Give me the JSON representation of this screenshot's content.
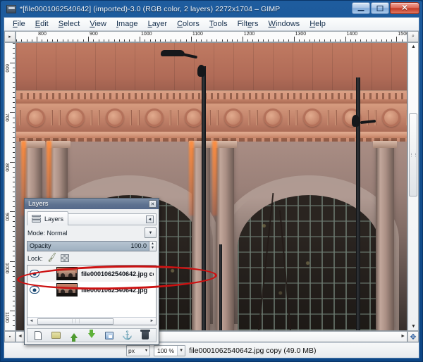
{
  "window": {
    "title": "*[file0001062540642] (imported)-3.0 (RGB color, 2 layers) 2272x1704 – GIMP",
    "app_name": "GIMP",
    "icon": "gimp-wilber-icon",
    "controls": {
      "minimize": "–",
      "maximize": "□",
      "close": "✕"
    },
    "accent_color": "#14508f"
  },
  "menubar": {
    "items": [
      {
        "label": "File"
      },
      {
        "label": "Edit"
      },
      {
        "label": "Select"
      },
      {
        "label": "View"
      },
      {
        "label": "Image"
      },
      {
        "label": "Layer"
      },
      {
        "label": "Colors"
      },
      {
        "label": "Tools"
      },
      {
        "label": "Filters"
      },
      {
        "label": "Windows"
      },
      {
        "label": "Help"
      }
    ]
  },
  "rulers": {
    "unit": "px",
    "horizontal": {
      "labels": [
        "800",
        "900",
        "1000",
        "1100",
        "1200",
        "1300",
        "1400",
        "1500"
      ],
      "start_value": 760,
      "end_value": 1520
    },
    "vertical": {
      "labels": [
        "600",
        "700",
        "800",
        "900",
        "1000",
        "1100"
      ],
      "start_value": 560,
      "end_value": 1140
    }
  },
  "canvas": {
    "corner_tl_icon": "ruler-origin-icon",
    "corner_tr_icon": "zoom-image-window-icon",
    "corner_bl_icon": "quick-mask-icon",
    "corner_br_icon": "navigation-move-icon",
    "image_description": "Photograph of a classical stone railway station facade at sunset, warm orange light on carved cornice with circular roundels, two large arched windows, street lamp posts and bare trees in foreground"
  },
  "layers_dialog": {
    "title": "Layers",
    "close_icon": "close-icon",
    "tab": {
      "label": "Layers",
      "icon": "layers-stack-icon",
      "menu_icon": "tab-menu-icon"
    },
    "mode": {
      "label": "Mode:",
      "value": "Normal",
      "full_label": "Mode: Normal",
      "dropdown_icon": "chevron-down-icon"
    },
    "opacity": {
      "label": "Opacity",
      "value": "100.0",
      "spinner_up": "▲",
      "spinner_down": "▼"
    },
    "lock": {
      "label": "Lock:",
      "pixels_icon": "lock-pixels-brush-icon",
      "alpha_icon": "lock-alpha-checker-icon"
    },
    "layers": [
      {
        "name": "file0001062540642.jpg co",
        "visible": true,
        "selected": true,
        "visibility_icon": "eye-icon",
        "thumbnail": "layer-thumbnail"
      },
      {
        "name": "file0001062540642.jpg",
        "visible": true,
        "selected": false,
        "visibility_icon": "eye-icon",
        "thumbnail": "layer-thumbnail"
      }
    ],
    "list_scroll": {
      "left_arrow": "◄",
      "right_arrow": "►",
      "grip": "⋮⋮⋮"
    },
    "toolbar": [
      {
        "name": "new-layer",
        "icon": "new-layer-icon"
      },
      {
        "name": "new-layer-group",
        "icon": "folder-icon"
      },
      {
        "name": "raise-layer",
        "icon": "arrow-up-icon"
      },
      {
        "name": "lower-layer",
        "icon": "arrow-down-icon"
      },
      {
        "name": "duplicate-layer",
        "icon": "duplicate-icon"
      },
      {
        "name": "anchor-layer",
        "icon": "anchor-icon"
      },
      {
        "name": "delete-layer",
        "icon": "trash-icon"
      }
    ]
  },
  "annotation": {
    "shape": "ellipse",
    "color": "#cc1111",
    "target": "selected layer row"
  },
  "statusbar": {
    "unit": "px",
    "unit_arrow": "▼",
    "zoom": "100 %",
    "zoom_arrow": "▼",
    "message": "file0001062540642.jpg copy (49.0 MB)"
  }
}
